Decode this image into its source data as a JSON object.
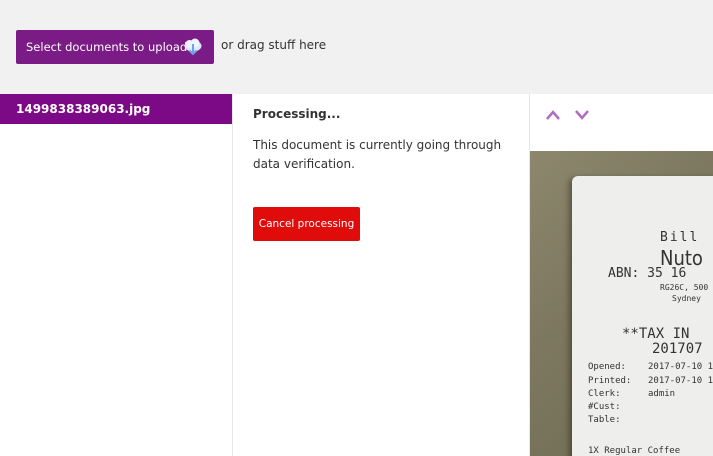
{
  "toolbar": {
    "upload_label": "Select documents to upload",
    "upload_icon": "cloud-upload-icon",
    "drag_hint": "or drag stuff here"
  },
  "files": [
    {
      "name": "1499838389063.jpg",
      "selected": true
    }
  ],
  "status": {
    "title": "Processing...",
    "description": "This document is currently going through data verification.",
    "cancel_label": "Cancel processing"
  },
  "preview": {
    "nav_icons": [
      "chevron-up-icon",
      "chevron-down-icon"
    ],
    "receipt_lines": {
      "bill": "Bill",
      "name": "Nuto",
      "abn": "ABN: 35 16",
      "addr1": "RG26C, 500",
      "addr2": "Sydney",
      "tax": "**TAX IN",
      "date": "201707",
      "opened_label": "Opened:",
      "opened_val": "2017-07-10 1",
      "printed_label": "Printed:",
      "printed_val": "2017-07-10 1",
      "clerk_label": "Clerk:",
      "clerk_val": "admin",
      "cust_label": "#Cust:",
      "table_label": "Table:",
      "item": "1X Regular Coffee"
    }
  },
  "colors": {
    "brand": "#7b1b86",
    "selected_file": "#7c0a86",
    "cancel": "#e00c0c",
    "arrows": "#b06cc0"
  }
}
